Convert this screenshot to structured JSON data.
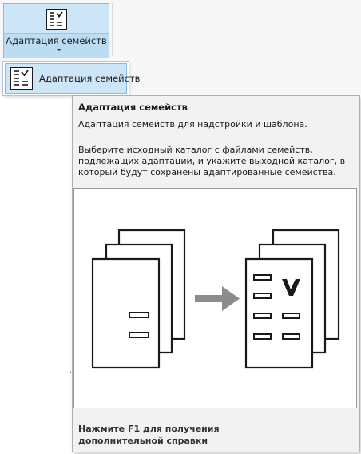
{
  "ribbon": {
    "button_label": "Адаптация семейств"
  },
  "menu": {
    "item_label": "Адаптация семейств"
  },
  "tooltip": {
    "title": "Адаптация семейств",
    "description": "Адаптация семейств для надстройки и шаблона.",
    "body_lines": [
      "Выберите исходный каталог с файлами семейств,",
      "подлежащих адаптации, и укажите выходной каталог, в",
      "который будут сохранены адаптированные семейства."
    ],
    "help_lines": [
      "Нажмите F1 для получения",
      "дополнительной справки"
    ]
  },
  "icons": {
    "ribbon_button": "family-adapt-icon",
    "menu_item": "family-adapt-icon",
    "dropdown": "chevron-down-icon",
    "illustration": [
      "stacked-documents-icon",
      "arrow-right-icon",
      "checklist-documents-icon"
    ]
  },
  "colors": {
    "highlight": "#cde6f7",
    "highlight_border": "#8cb8d9",
    "tooltip_bg": "#f2f2f2",
    "arrow": "#8c8c8c"
  }
}
